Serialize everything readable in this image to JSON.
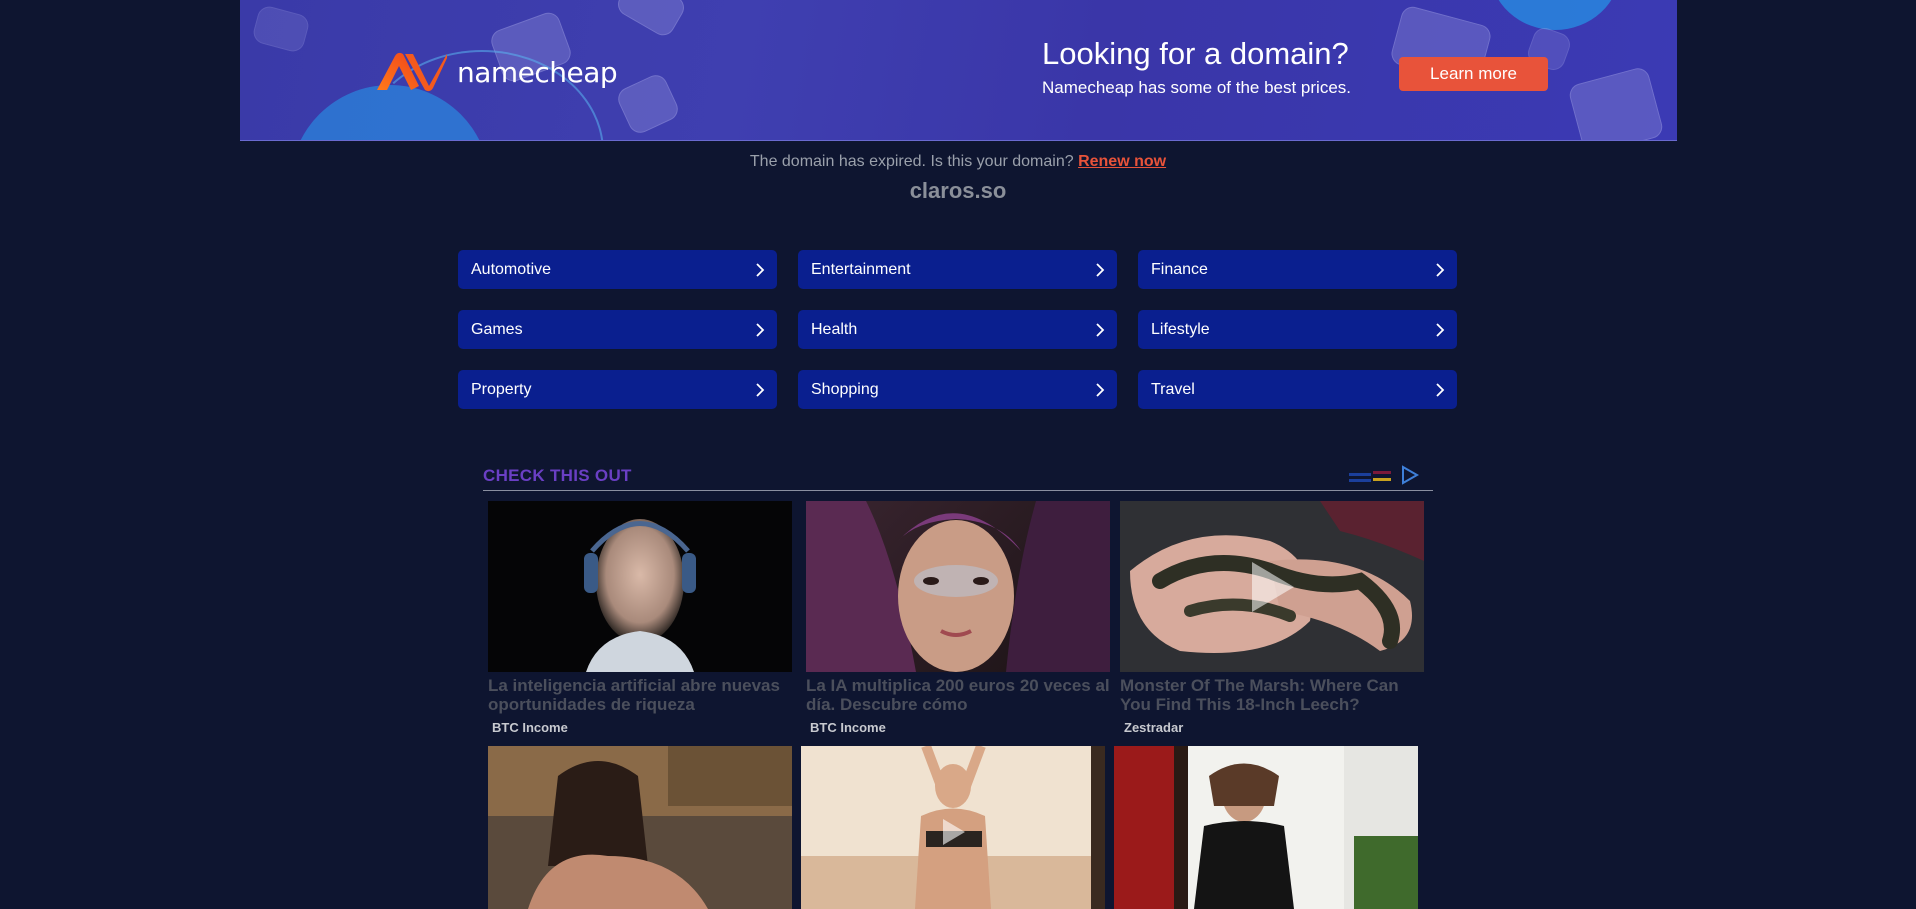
{
  "banner": {
    "brand": "namecheap",
    "headline": "Looking for a domain?",
    "subheadline": "Namecheap has some of the best prices.",
    "cta_label": "Learn more",
    "brand_color": "#f26b2b",
    "cta_color": "#e8533a"
  },
  "notice": {
    "text": "The domain has expired. Is this your domain?",
    "link_label": "Renew now",
    "domain": "claros.so"
  },
  "categories": [
    {
      "label": "Automotive"
    },
    {
      "label": "Entertainment"
    },
    {
      "label": "Finance"
    },
    {
      "label": "Games"
    },
    {
      "label": "Health"
    },
    {
      "label": "Lifestyle"
    },
    {
      "label": "Property"
    },
    {
      "label": "Shopping"
    },
    {
      "label": "Travel"
    }
  ],
  "feed": {
    "title": "CHECK THIS OUT",
    "cards": [
      {
        "headline": "La inteligencia artificial abre nuevas oportunidades de riqueza",
        "source": "BTC Income",
        "has_play": false
      },
      {
        "headline": "La IA multiplica 200 euros 20 veces al día. Descubre cómo",
        "source": "BTC Income",
        "has_play": false
      },
      {
        "headline": "Monster Of The Marsh: Where Can You Find This 18-Inch Leech?",
        "source": "Zestradar",
        "has_play": true
      },
      {
        "headline": "",
        "source": "",
        "has_play": false
      },
      {
        "headline": "",
        "source": "",
        "has_play": true
      },
      {
        "headline": "",
        "source": "",
        "has_play": false
      }
    ]
  }
}
